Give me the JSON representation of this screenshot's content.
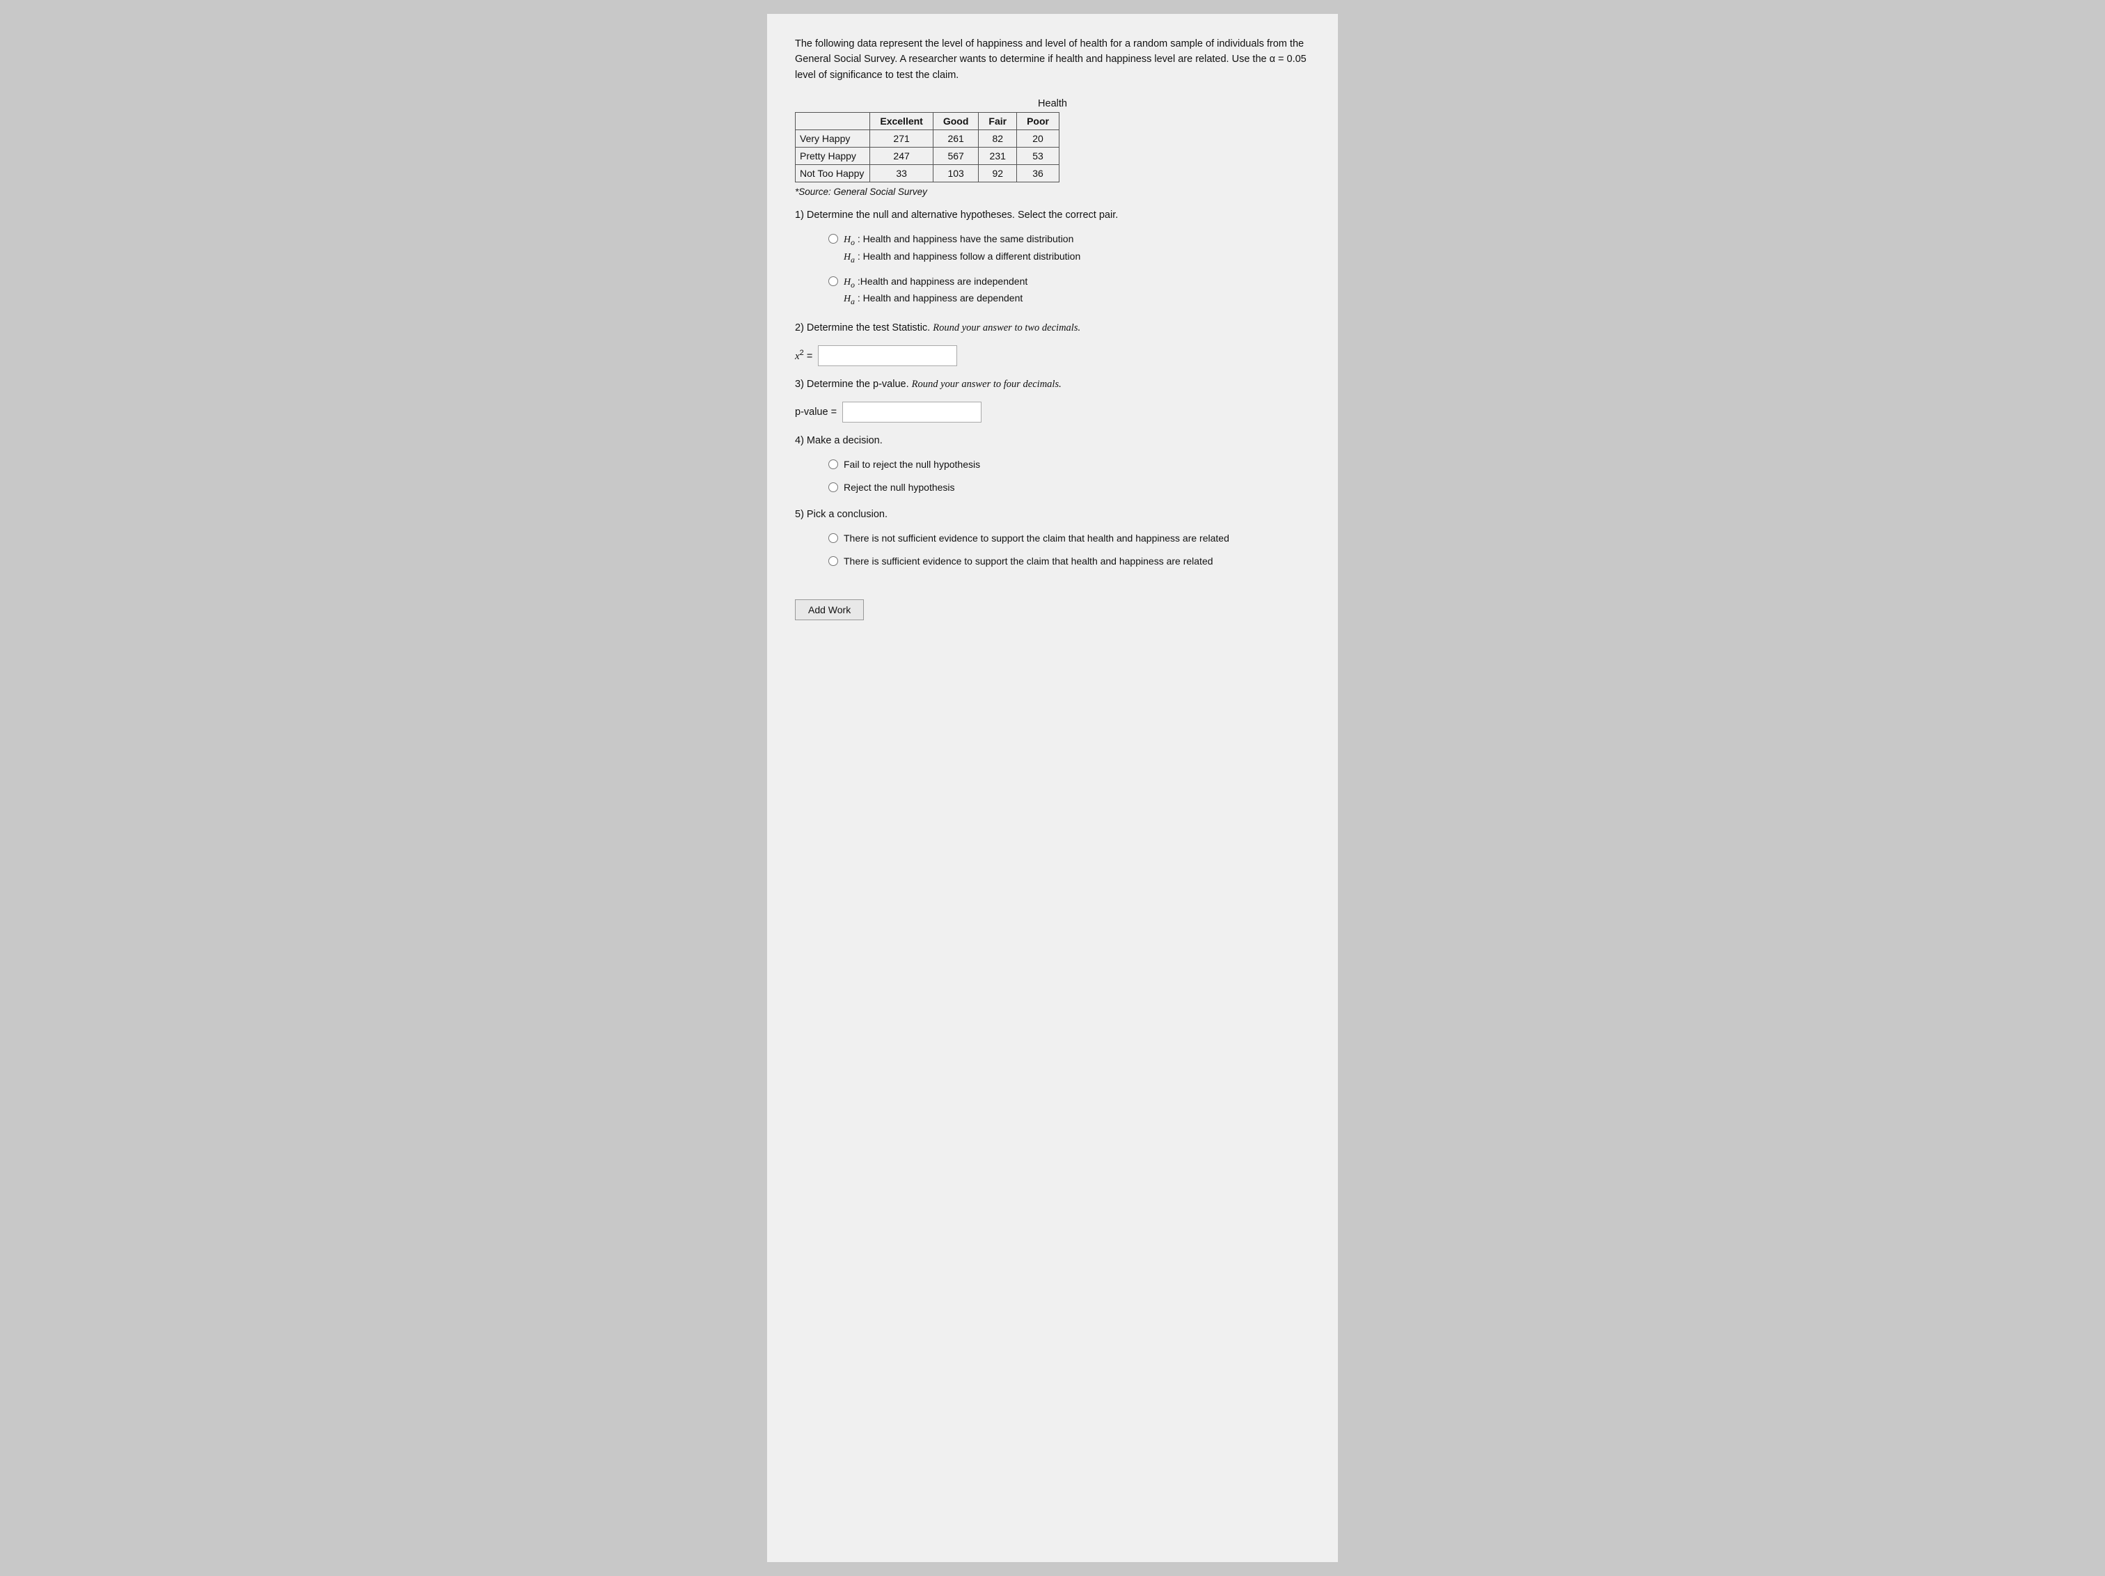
{
  "intro": {
    "text": "The following data represent the level of happiness and level of health for a random sample of individuals from the General Social Survey. A researcher wants to determine if health and happiness level are related. Use the α = 0.05 level of significance to test the claim."
  },
  "table": {
    "health_label": "Health",
    "header_row": [
      "",
      "Excellent",
      "Good",
      "Fair",
      "Poor"
    ],
    "rows": [
      {
        "label": "Very Happy",
        "excellent": "271",
        "good": "261",
        "fair": "82",
        "poor": "20"
      },
      {
        "label": "Pretty Happy",
        "excellent": "247",
        "good": "567",
        "fair": "231",
        "poor": "53"
      },
      {
        "label": "Not Too Happy",
        "excellent": "33",
        "good": "103",
        "fair": "92",
        "poor": "36"
      }
    ],
    "source": "*Source: General Social Survey"
  },
  "q1": {
    "text": "1) Determine the null and alternative hypotheses. Select the correct pair.",
    "options": [
      {
        "id": "opt1a",
        "h0": "H₀ : Health and happiness have the same distribution",
        "ha": "Hₐ : Health and happiness follow a different distribution"
      },
      {
        "id": "opt1b",
        "h0": "H₀ :Health and happiness are independent",
        "ha": "Hₐ : Health and happiness are dependent"
      }
    ]
  },
  "q2": {
    "text": "2) Determine the test Statistic.",
    "note": "Round your answer to two decimals.",
    "label": "χ² =",
    "placeholder": ""
  },
  "q3": {
    "text": "3) Determine the p-value.",
    "note": "Round your answer to four decimals.",
    "label": "p-value =",
    "placeholder": ""
  },
  "q4": {
    "text": "4) Make a decision.",
    "options": [
      "Fail to reject the null hypothesis",
      "Reject the null hypothesis"
    ]
  },
  "q5": {
    "text": "5) Pick a conclusion.",
    "options": [
      "There is not sufficient evidence to support the claim that health and happiness are related",
      "There is sufficient evidence to support the claim that health and happiness are related"
    ]
  },
  "add_work_button": "Add Work"
}
